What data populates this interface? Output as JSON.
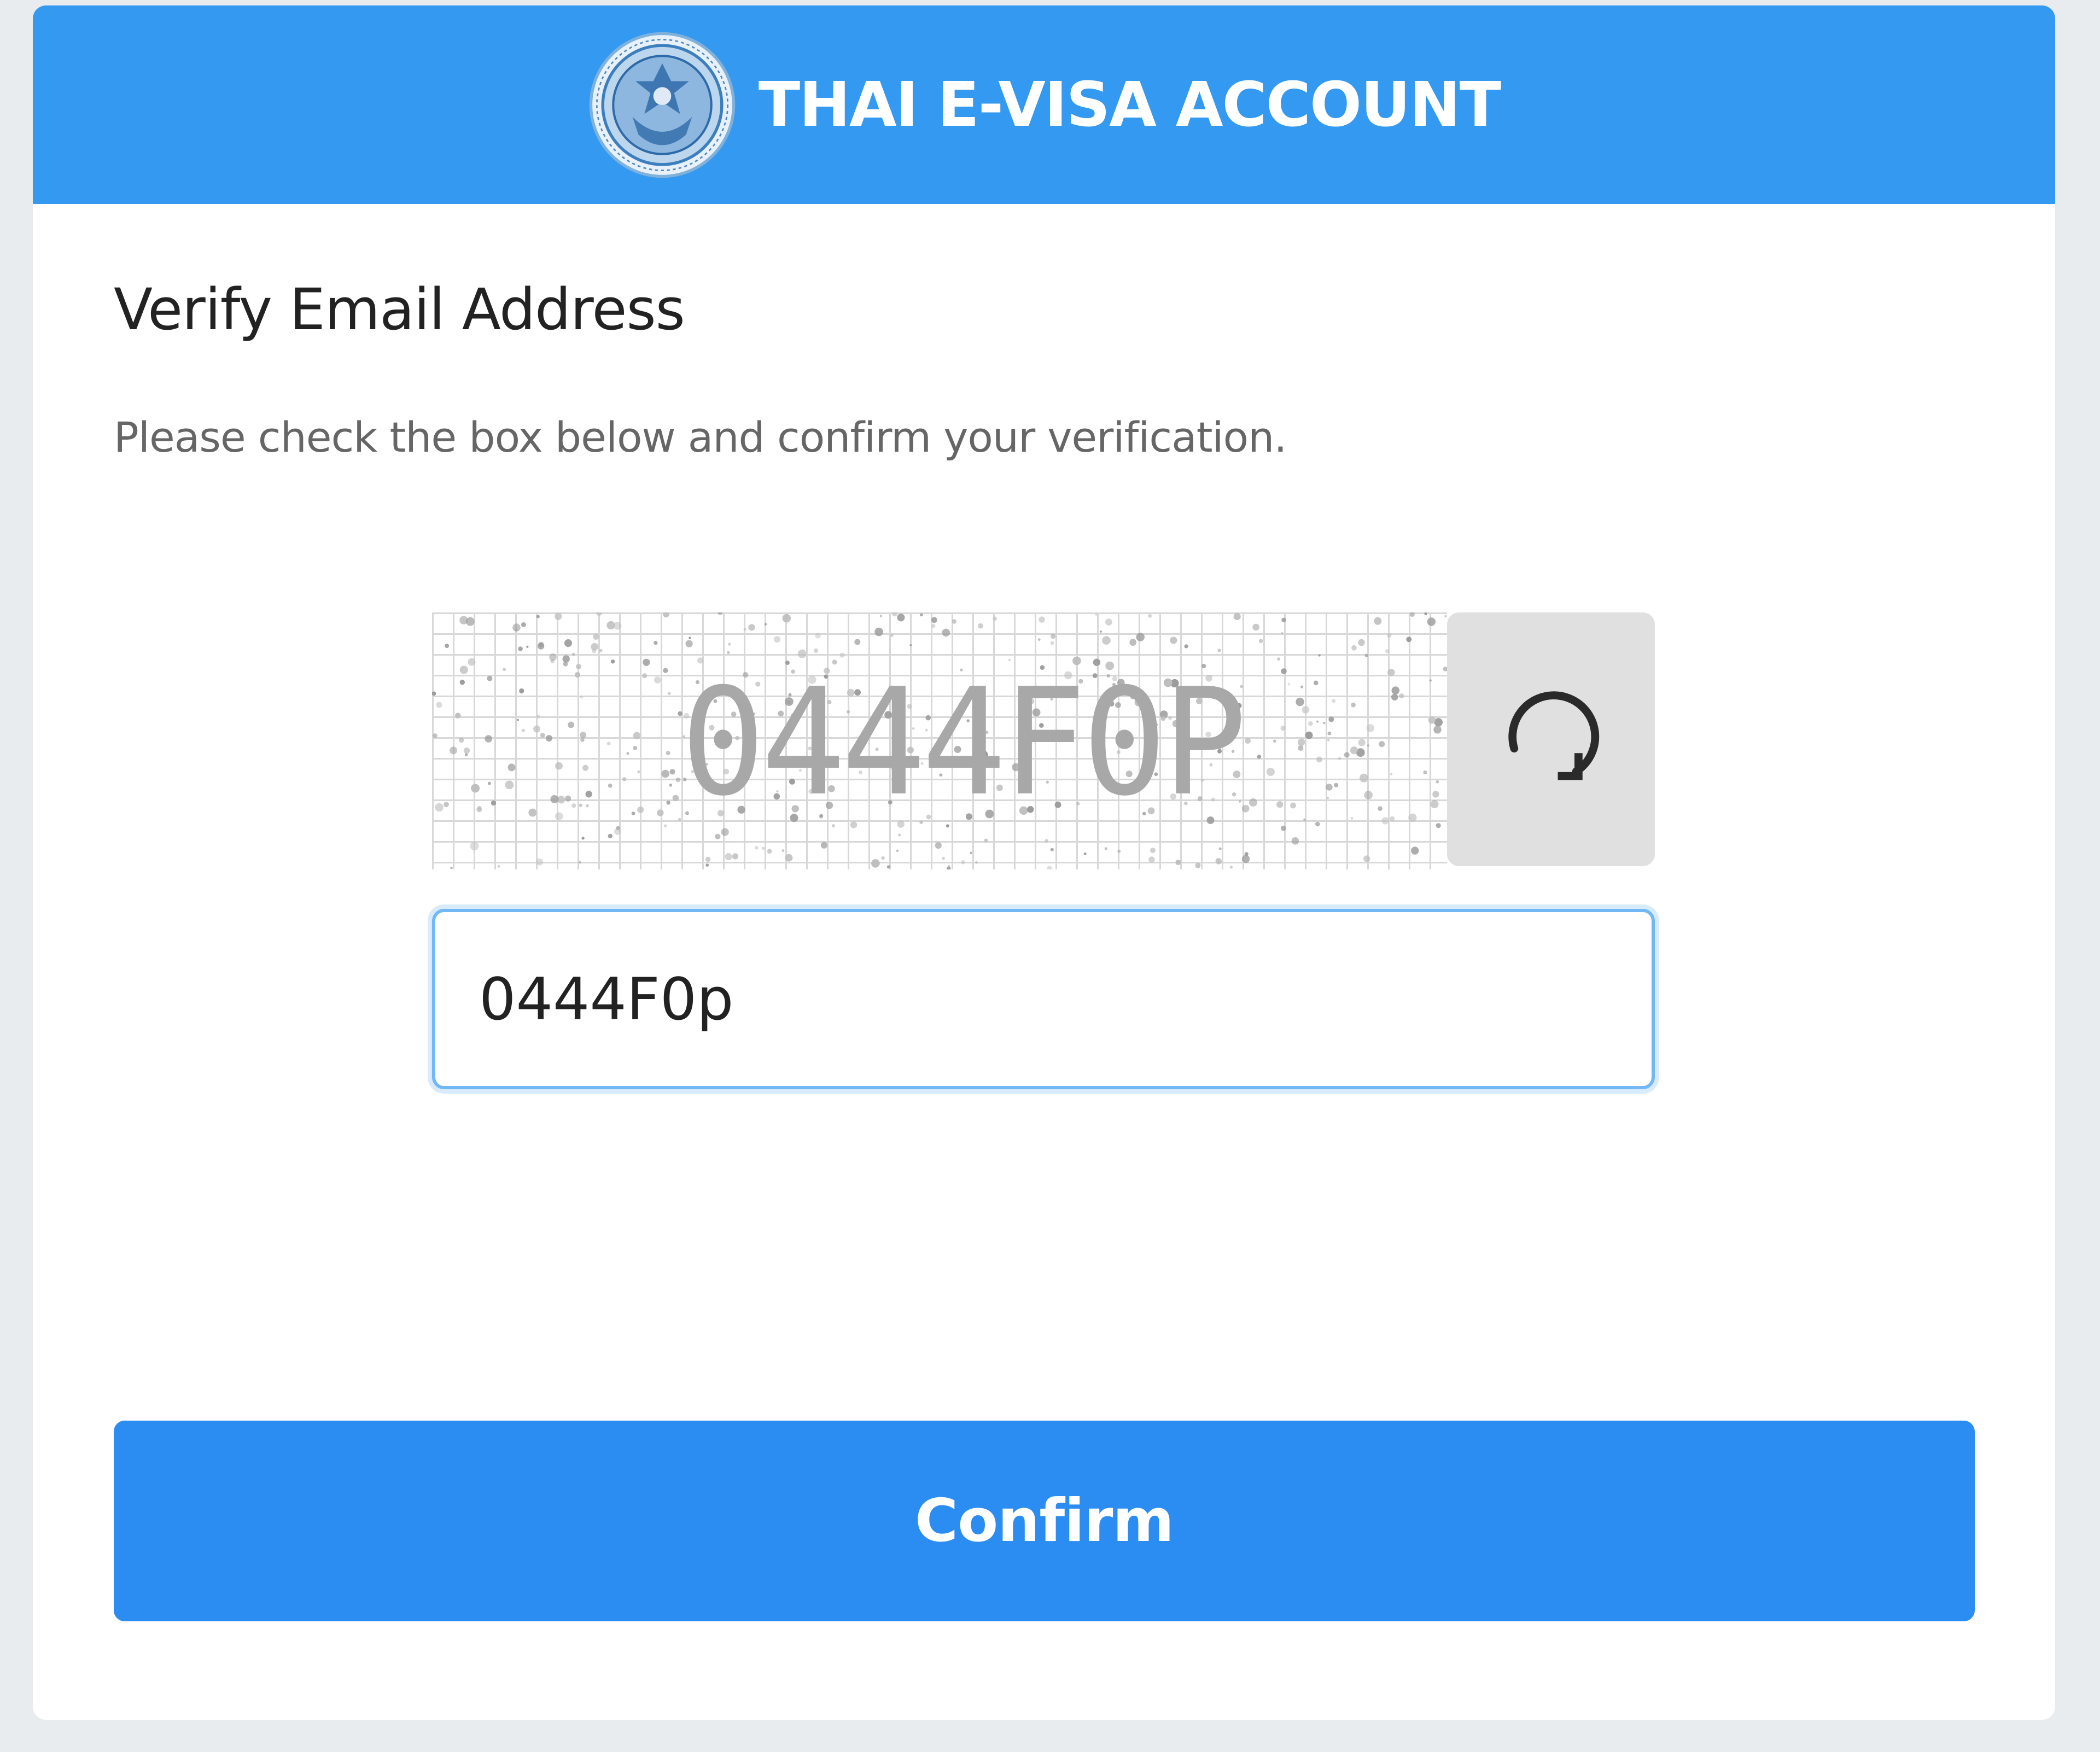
{
  "header": {
    "title": "THAI E-VISA ACCOUNT",
    "logo_icon": "thai-government-seal-icon"
  },
  "form": {
    "title": "Verify Email Address",
    "instruction": "Please check the box below and confirm your verification.",
    "captcha_text": "0444F0P",
    "refresh_icon": "refresh-icon",
    "captcha_input_value": "0444F0p",
    "confirm_label": "Confirm"
  },
  "colors": {
    "header_bg": "#3499f0",
    "button_bg": "#2b8cf2",
    "page_bg": "#e9ecef",
    "input_focus_border": "#72b8f5"
  }
}
